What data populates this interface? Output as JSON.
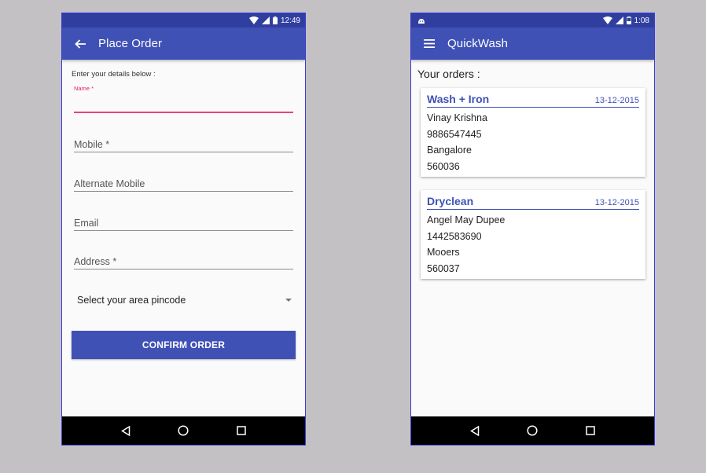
{
  "left_phone": {
    "status_bar": {
      "time": "12:49"
    },
    "app_bar": {
      "title": "Place Order"
    },
    "form": {
      "intro": "Enter your details below :",
      "fields": [
        {
          "label": "Name *",
          "focused": true
        },
        {
          "label": "Mobile *"
        },
        {
          "label": "Alternate Mobile"
        },
        {
          "label": "Email"
        },
        {
          "label": "Address *"
        }
      ],
      "pincode_select": "Select your area pincode",
      "confirm_label": "CONFIRM ORDER"
    }
  },
  "right_phone": {
    "status_bar": {
      "time": "1:08"
    },
    "app_bar": {
      "title": "QuickWash"
    },
    "orders_heading": "Your orders :",
    "orders": [
      {
        "service": "Wash + Iron",
        "date": "13-12-2015",
        "name": "Vinay Krishna",
        "phone": "9886547445",
        "city": "Bangalore",
        "pincode": "560036"
      },
      {
        "service": "Dryclean",
        "date": "13-12-2015",
        "name": "Angel May Dupee",
        "phone": "1442583690",
        "city": "Mooers",
        "pincode": "560037"
      }
    ]
  },
  "colors": {
    "primary": "#3f51b5",
    "primary_dark": "#303f9f",
    "accent": "#ec407a",
    "background": "#c3c1c4"
  },
  "icons": {
    "back": "arrow-left-icon",
    "menu": "hamburger-menu-icon",
    "wifi": "wifi-icon",
    "signal": "signal-icon",
    "battery": "battery-icon",
    "android": "android-notification-icon",
    "nav_back": "triangle-back-icon",
    "nav_home": "circle-home-icon",
    "nav_recents": "square-recents-icon"
  }
}
